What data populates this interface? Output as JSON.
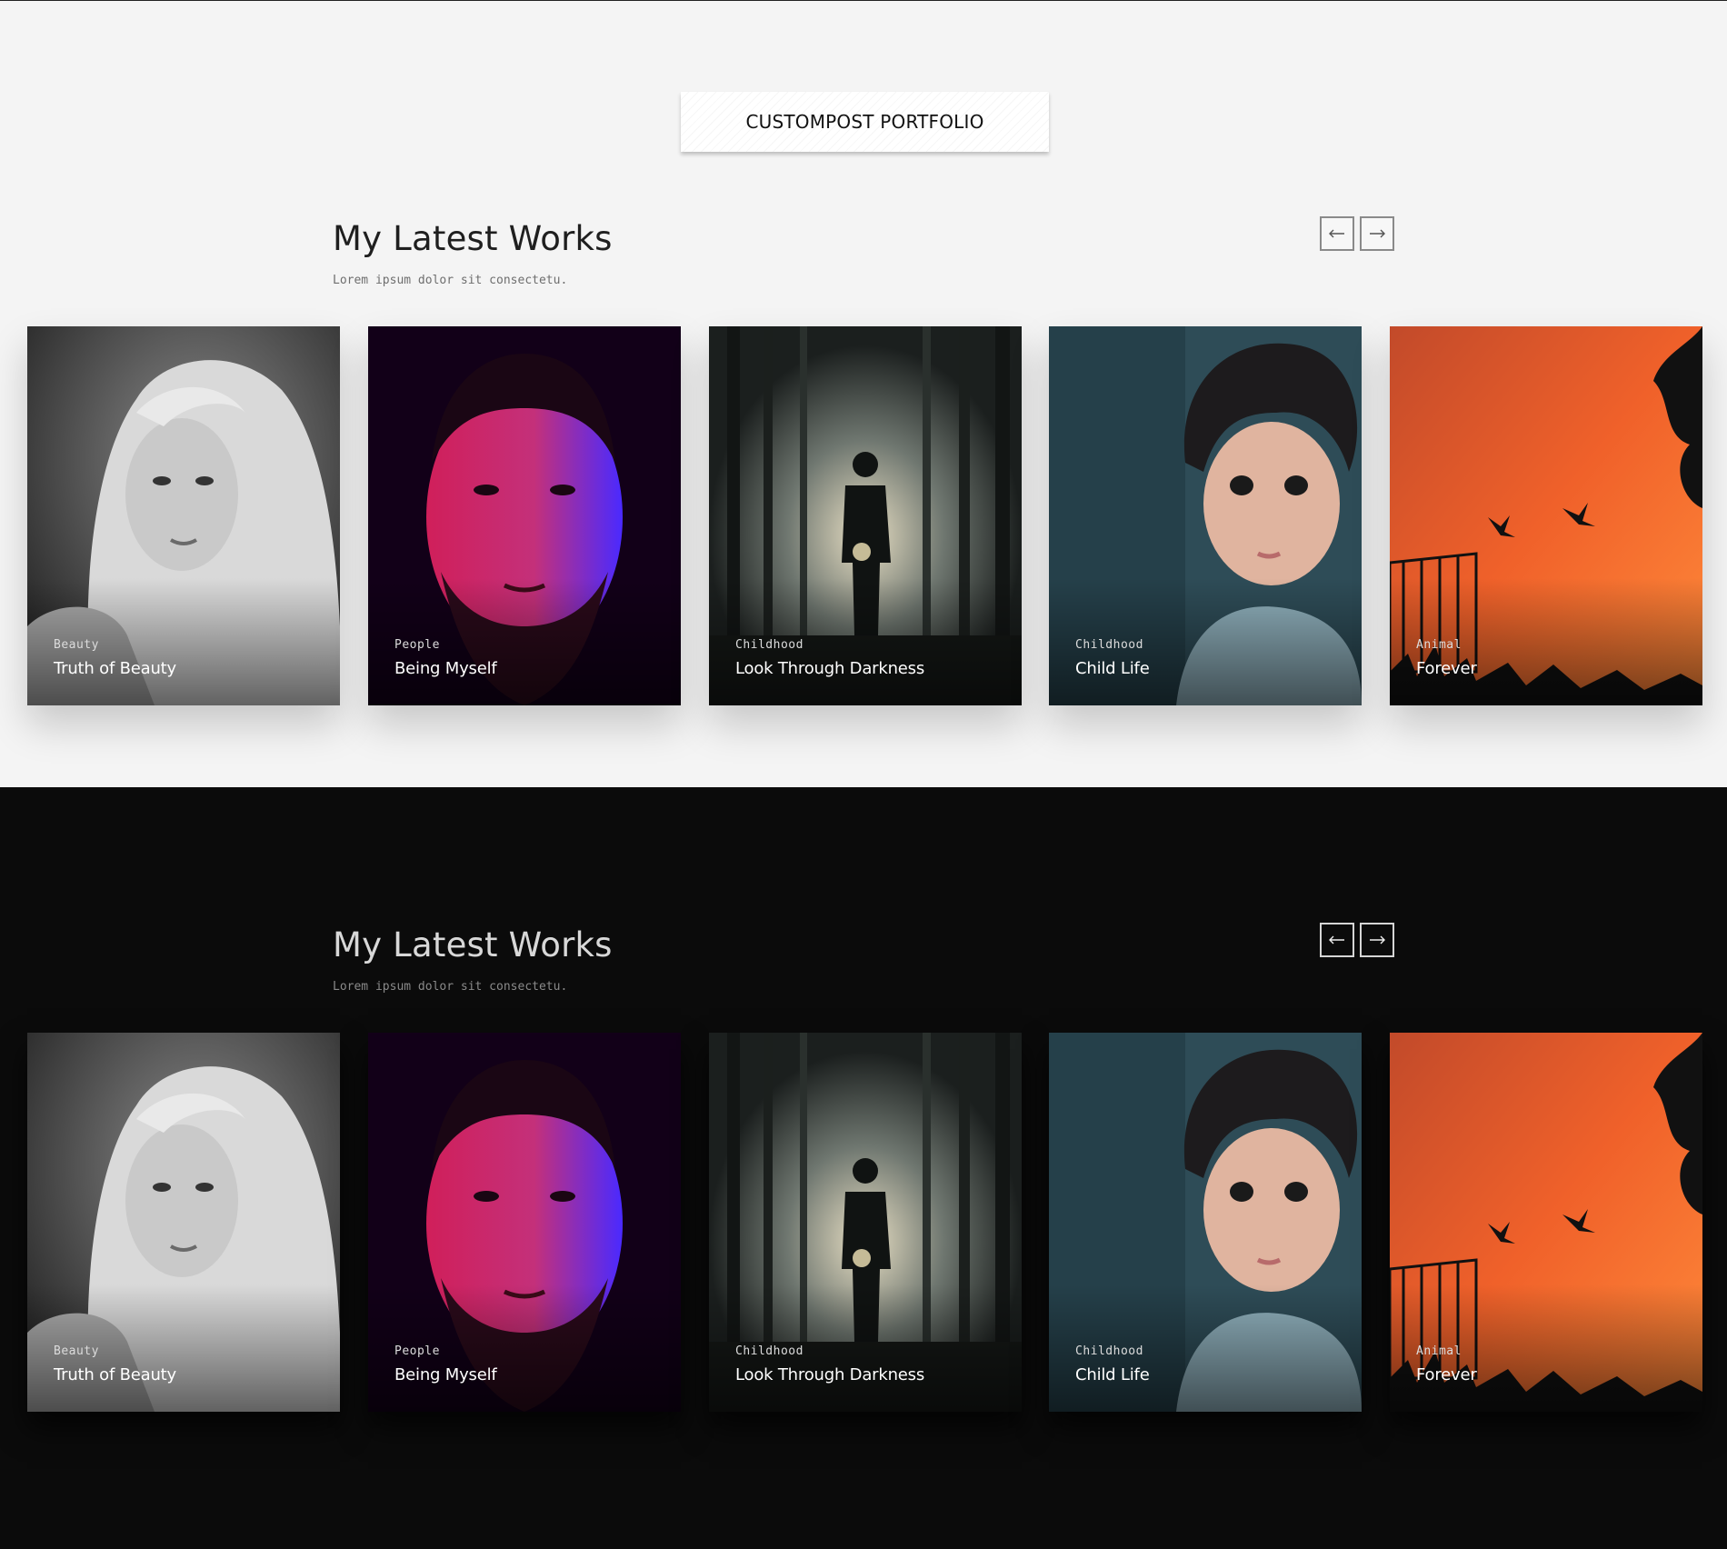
{
  "section_label": "CUSTOMPOST PORTFOLIO",
  "light_section": {
    "heading": "My Latest Works",
    "subheading": "Lorem ipsum dolor sit consectetu.",
    "prev_icon": "arrow-left-icon",
    "next_icon": "arrow-right-icon"
  },
  "dark_section": {
    "heading": "My Latest Works",
    "subheading": "Lorem ipsum dolor sit consectetu.",
    "prev_icon": "arrow-left-icon",
    "next_icon": "arrow-right-icon"
  },
  "portfolio_items": [
    {
      "category": "Beauty",
      "title": "Truth of Beauty"
    },
    {
      "category": "People",
      "title": "Being Myself"
    },
    {
      "category": "Childhood",
      "title": "Look Through Darkness"
    },
    {
      "category": "Childhood",
      "title": "Child Life"
    },
    {
      "category": "Animal",
      "title": "Forever"
    }
  ],
  "colors": {
    "light_background": "#f4f4f4",
    "dark_background": "#0b0b0b",
    "sunset_orange": "#f0612a",
    "portrait_magenta": "#d01f5a"
  }
}
